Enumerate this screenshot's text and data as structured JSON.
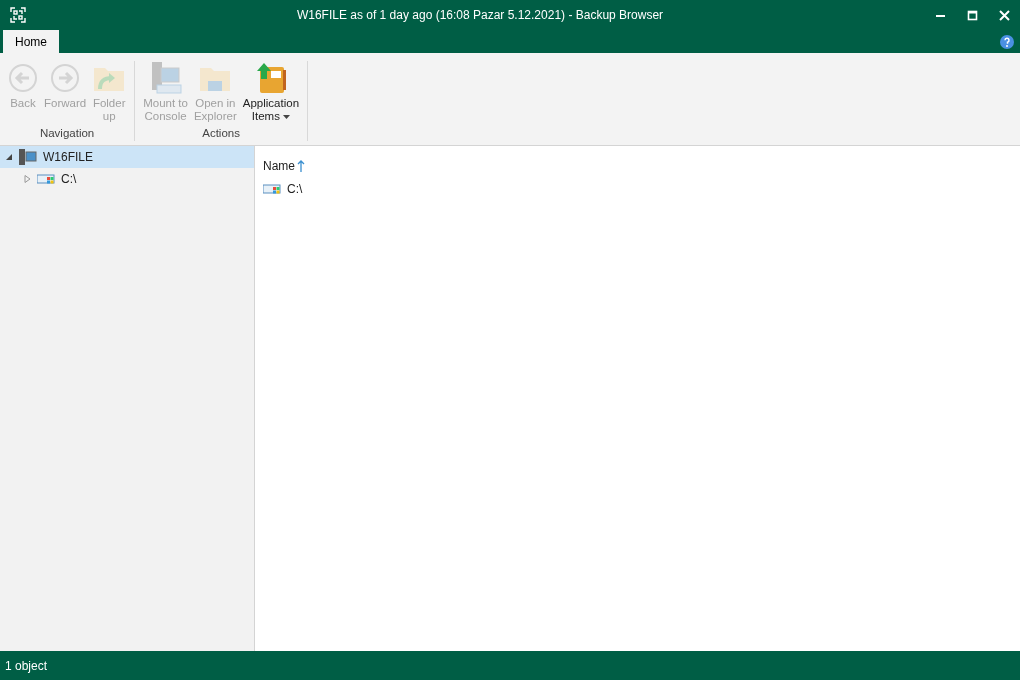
{
  "window": {
    "title": "W16FILE as of 1 day ago (16:08 Pazar 5.12.2021) - Backup Browser"
  },
  "tabs": [
    {
      "label": "Home",
      "selected": true
    }
  ],
  "ribbon": {
    "groups": [
      {
        "label": "Navigation",
        "buttons": [
          {
            "kind": "back",
            "label": "Back",
            "disabled": true
          },
          {
            "kind": "forward",
            "label": "Forward",
            "disabled": true
          },
          {
            "kind": "folderup",
            "label": "Folder up",
            "disabled": true
          }
        ]
      },
      {
        "label": "Actions",
        "buttons": [
          {
            "kind": "mount",
            "label": "Mount to Console",
            "disabled": true
          },
          {
            "kind": "explorer",
            "label": "Open in Explorer",
            "disabled": true
          },
          {
            "kind": "appitems",
            "label": "Application Items",
            "disabled": false,
            "dropdown": true
          }
        ]
      }
    ]
  },
  "tree": [
    {
      "label": "W16FILE",
      "kind": "server",
      "selected": true,
      "expanded": true,
      "children": [
        {
          "label": "C:\\",
          "kind": "drive",
          "selected": false,
          "expanded": false
        }
      ]
    }
  ],
  "list": {
    "columns": [
      {
        "label": "Name",
        "sorted": true
      }
    ],
    "rows": [
      {
        "name": "C:\\",
        "kind": "drive"
      }
    ]
  },
  "status_bar": {
    "text": "1 object"
  }
}
